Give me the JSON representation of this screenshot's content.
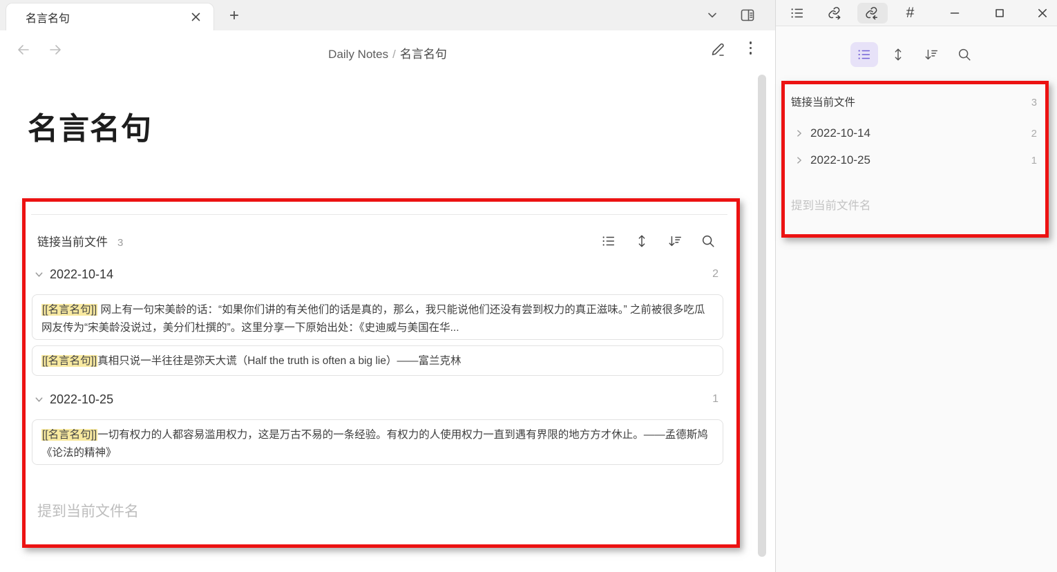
{
  "tabbar": {
    "tab_title": "名言名句",
    "new_tab_glyph": "+"
  },
  "breadcrumb": {
    "parent": "Daily Notes",
    "separator": "/",
    "current": "名言名句"
  },
  "page": {
    "title": "名言名句"
  },
  "backlinks": {
    "linked_header": "链接当前文件",
    "linked_count": "3",
    "groups": [
      {
        "title": "2022-10-14",
        "count": "2",
        "matches": [
          {
            "highlight": "[[名言名句]]",
            "text": " 网上有一句宋美龄的话：“如果你们讲的有关他们的话是真的，那么，我只能说他们还没有尝到权力的真正滋味。” 之前被很多吃瓜网友传为“宋美龄没说过，美分们杜撰的”。这里分享一下原始出处：《史迪威与美国在华..."
          },
          {
            "highlight": "[[名言名句]]",
            "text": "真相只说一半往往是弥天大谎（Half the truth is often a big lie）——富兰克林"
          }
        ]
      },
      {
        "title": "2022-10-25",
        "count": "1",
        "matches": [
          {
            "highlight": "[[名言名句]]",
            "text": "一切有权力的人都容易滥用权力，这是万古不易的一条经验。有权力的人使用权力一直到遇有界限的地方方才休止。——孟德斯鸠《论法的精神》"
          }
        ]
      }
    ],
    "unlinked_header": "提到当前文件名"
  },
  "sidebar": {
    "linked_header": "链接当前文件",
    "linked_count": "3",
    "items": [
      {
        "title": "2022-10-14",
        "count": "2"
      },
      {
        "title": "2022-10-25",
        "count": "1"
      }
    ],
    "unlinked_header": "提到当前文件名"
  },
  "icons": {
    "hash_glyph": "#"
  },
  "colors": {
    "accent_purple": "#7463d6",
    "highlight_yellow": "#f8e9a0",
    "annotation_red": "#ec1212"
  }
}
